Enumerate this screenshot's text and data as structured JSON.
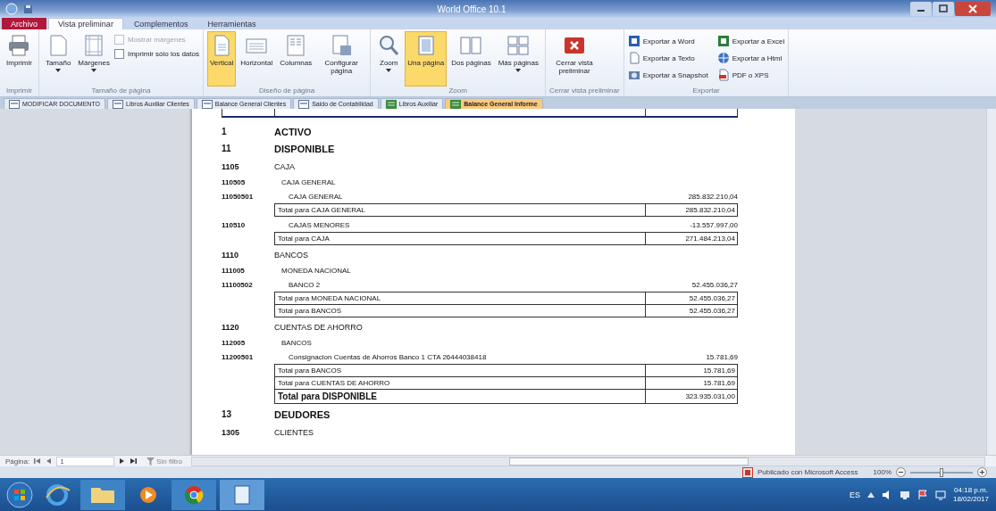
{
  "window": {
    "title": "World Office 10.1"
  },
  "ribbon_tabs": [
    {
      "label": "Archivo",
      "kind": "file",
      "selected": false
    },
    {
      "label": "Vista preliminar",
      "kind": "tab",
      "selected": true
    },
    {
      "label": "Complementos",
      "kind": "tab",
      "selected": false
    },
    {
      "label": "Herramientas",
      "kind": "tab",
      "selected": false
    }
  ],
  "ribbon_groups": [
    {
      "label": "Imprimir",
      "buttons": [
        {
          "label": "Imprimir",
          "dropdown": false,
          "selected": false
        }
      ]
    },
    {
      "label": "Tamaño de página",
      "buttons": [
        {
          "label": "Tamaño",
          "dropdown": true,
          "selected": false
        },
        {
          "label": "Márgenes",
          "dropdown": true,
          "selected": false
        }
      ],
      "options": [
        {
          "kind": "check",
          "label": "Mostrar márgenes",
          "checked": false,
          "disabled": true
        },
        {
          "kind": "check",
          "label": "Imprimir sólo los datos",
          "checked": false,
          "disabled": false
        }
      ]
    },
    {
      "label": "Diseño de página",
      "buttons": [
        {
          "label": "Vertical",
          "dropdown": false,
          "selected": true
        },
        {
          "label": "Horizontal",
          "dropdown": false,
          "selected": false
        },
        {
          "label": "Columnas",
          "dropdown": false,
          "selected": false
        },
        {
          "label": "Configurar página",
          "dropdown": false,
          "selected": false
        }
      ]
    },
    {
      "label": "Zoom",
      "buttons": [
        {
          "label": "Zoom",
          "dropdown": true,
          "selected": false
        },
        {
          "label": "Una página",
          "dropdown": false,
          "selected": true
        },
        {
          "label": "Dos páginas",
          "dropdown": false,
          "selected": false
        },
        {
          "label": "Más páginas",
          "dropdown": true,
          "selected": false
        }
      ]
    },
    {
      "label": "Cerrar vista preliminar",
      "buttons": [
        {
          "label": "Cerrar vista preliminar",
          "dropdown": false,
          "selected": false
        }
      ]
    },
    {
      "label": "Exportar",
      "options": [
        {
          "kind": "small",
          "label": "Exportar a Word"
        },
        {
          "kind": "small",
          "label": "Exportar a Texto"
        },
        {
          "kind": "small",
          "label": "Exportar a Snapshot"
        },
        {
          "kind": "small",
          "label": "Exportar a Excel"
        },
        {
          "kind": "small",
          "label": "Exportar a Html"
        },
        {
          "kind": "small",
          "label": "PDF o XPS"
        }
      ]
    }
  ],
  "document_tabs": [
    {
      "label": "MODIFICAR DOCUMENTO",
      "kind": "form",
      "selected": false
    },
    {
      "label": "Libros Auxiliar Clientes",
      "kind": "form",
      "selected": false
    },
    {
      "label": "Balance General Clientes",
      "kind": "form",
      "selected": false
    },
    {
      "label": "Saldo de Contabilidad",
      "kind": "form",
      "selected": false
    },
    {
      "label": "Libros Auxiliar",
      "kind": "report",
      "selected": false
    },
    {
      "label": "Balance General Informe",
      "kind": "report",
      "selected": true
    }
  ],
  "report_rows": [
    {
      "kind": "heading",
      "code": "1",
      "name": "ACTIVO"
    },
    {
      "kind": "heading",
      "code": "11",
      "name": "DISPONIBLE"
    },
    {
      "kind": "group",
      "code": "1105",
      "name": "CAJA"
    },
    {
      "kind": "subgroup",
      "code": "110505",
      "name": "CAJA GENERAL"
    },
    {
      "kind": "account",
      "code": "11050501",
      "name": "CAJA GENERAL",
      "amount": "285.832.210,04"
    },
    {
      "kind": "total",
      "name": "Total para CAJA GENERAL",
      "amount": "285.832.210,04"
    },
    {
      "kind": "account",
      "code": "110510",
      "name": "CAJAS MENORES",
      "amount": "-13.557.997,00"
    },
    {
      "kind": "total",
      "name": "Total para CAJA",
      "amount": "271.484.213,04"
    },
    {
      "kind": "group",
      "code": "1110",
      "name": "BANCOS"
    },
    {
      "kind": "subgroup",
      "code": "111005",
      "name": "MONEDA NACIONAL"
    },
    {
      "kind": "account",
      "code": "11100502",
      "name": "BANCO 2",
      "amount": "52.455.036,27"
    },
    {
      "kind": "total",
      "name": "Total para MONEDA NACIONAL",
      "amount": "52.455.036,27"
    },
    {
      "kind": "total",
      "name": "Total para BANCOS",
      "amount": "52.455.036,27"
    },
    {
      "kind": "group",
      "code": "1120",
      "name": "CUENTAS DE AHORRO"
    },
    {
      "kind": "subgroup",
      "code": "112005",
      "name": "BANCOS"
    },
    {
      "kind": "account",
      "code": "11200501",
      "name": "Consignacion Cuentas de Ahorros Banco 1 CTA 26444038418",
      "amount": "15.781,69"
    },
    {
      "kind": "total",
      "name": "Total para BANCOS",
      "amount": "15.781,69"
    },
    {
      "kind": "total",
      "name": "Total para CUENTAS DE AHORRO",
      "amount": "15.781,69"
    },
    {
      "kind": "grand_total",
      "name": "Total para DISPONIBLE",
      "amount": "323.935.031,00"
    },
    {
      "kind": "heading",
      "code": "13",
      "name": "DEUDORES"
    },
    {
      "kind": "group",
      "code": "1305",
      "name": "CLIENTES"
    }
  ],
  "navigation": {
    "label": "Página:",
    "page": "1",
    "filter": "Sin filtro"
  },
  "status_bar": {
    "text": "Publicado con Microsoft Access",
    "zoom": "100%",
    "zoom_level": {
      "level": 0.5
    }
  },
  "taskbar": {
    "language": "ES",
    "time": "04:18 p.m.",
    "date": "18/02/2017"
  }
}
